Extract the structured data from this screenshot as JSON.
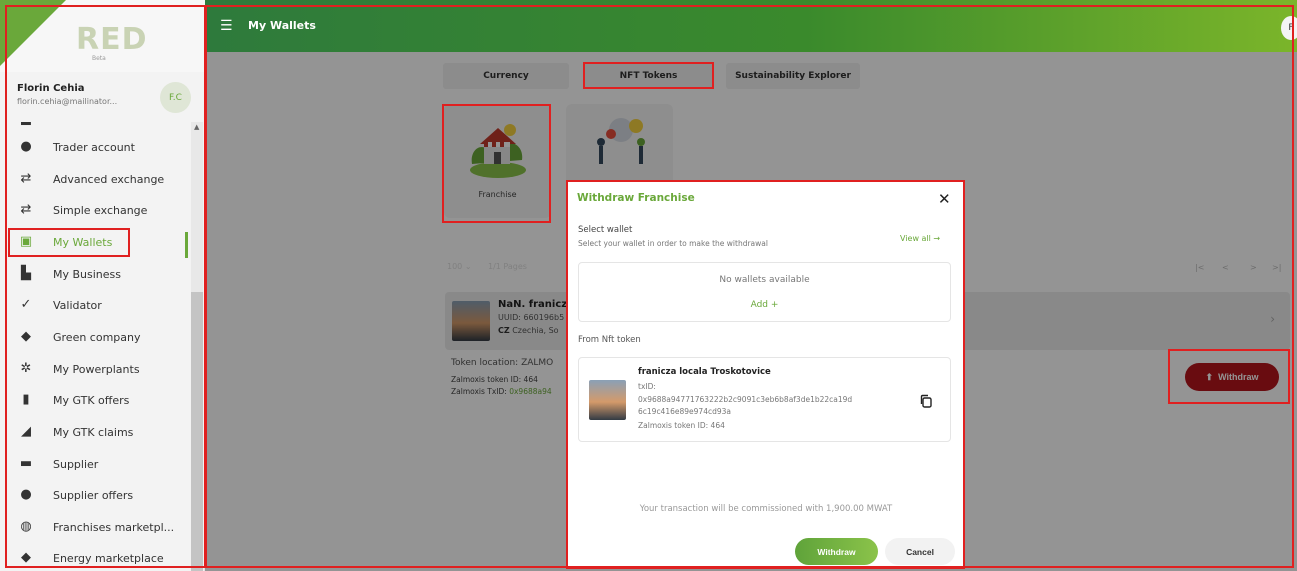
{
  "app": {
    "logo_text": "RED",
    "logo_sub": "Beta",
    "page_title": "My Wallets",
    "top_avatar": "F"
  },
  "user": {
    "name": "Florin Cehia",
    "email": "florin.cehia@mailinator...",
    "initials": "F.C"
  },
  "sidebar": {
    "items": [
      {
        "label": "Trader account",
        "icon": "trader-icon"
      },
      {
        "label": "Advanced exchange",
        "icon": "exchange-icon"
      },
      {
        "label": "Simple exchange",
        "icon": "exchange-icon"
      },
      {
        "label": "My Wallets",
        "icon": "wallet-icon",
        "active": true
      },
      {
        "label": "My Business",
        "icon": "business-icon"
      },
      {
        "label": "Validator",
        "icon": "validator-icon"
      },
      {
        "label": "Green company",
        "icon": "company-icon"
      },
      {
        "label": "My Powerplants",
        "icon": "powerplant-icon"
      },
      {
        "label": "My GTK offers",
        "icon": "offers-icon"
      },
      {
        "label": "My GTK claims",
        "icon": "claims-icon"
      },
      {
        "label": "Supplier",
        "icon": "truck-icon"
      },
      {
        "label": "Supplier offers",
        "icon": "supplier-offers-icon"
      },
      {
        "label": "Franchises marketpl...",
        "icon": "globe-icon"
      },
      {
        "label": "Energy marketplace",
        "icon": "marketplace-icon"
      }
    ]
  },
  "tabs": [
    {
      "label": "Currency"
    },
    {
      "label": "NFT Tokens",
      "active": true
    },
    {
      "label": "Sustainability Explorer"
    }
  ],
  "nft_categories": [
    {
      "label": "Franchise"
    },
    {
      "label": ""
    }
  ],
  "pagination": {
    "page_size": "100",
    "pages": "1/1 Pages",
    "nav": [
      "|<",
      "<",
      ">",
      ">|"
    ]
  },
  "token_row": {
    "title": "NaN. franicz",
    "uuid": "UUID: 660196b5",
    "country_code": "CZ",
    "country": "Czechia, So"
  },
  "token_details": {
    "location": "Token location: ZALMO",
    "token_id": "Zalmoxis token ID: 464",
    "txid_label": "Zalmoxis TxID: ",
    "txid_value": "0x9688a94"
  },
  "withdraw_label": "Withdraw",
  "modal": {
    "title": "Withdraw Franchise",
    "select_wallet_title": "Select wallet",
    "select_wallet_sub": "Select your wallet in order to make the withdrawal",
    "view_all": "View all →",
    "no_wallets": "No wallets available",
    "add": "Add +",
    "from_token_label": "From Nft token",
    "token": {
      "title": "franicza locala Troskotovice",
      "txid_label": "txID:",
      "txid_line1": "0x9688a94771763222b2c9091c3eb6b8af3de1b22ca19d",
      "txid_line2": "6c19c416e89e974cd93a",
      "token_id": "Zalmoxis token ID: 464"
    },
    "commission": "Your transaction will be commissioned with 1,900.00 MWAT",
    "withdraw_button": "Withdraw",
    "cancel_button": "Cancel"
  },
  "colors": {
    "accent_green": "#6aa83a",
    "withdraw_red": "#b5161c",
    "annotation_red": "#e02020"
  }
}
